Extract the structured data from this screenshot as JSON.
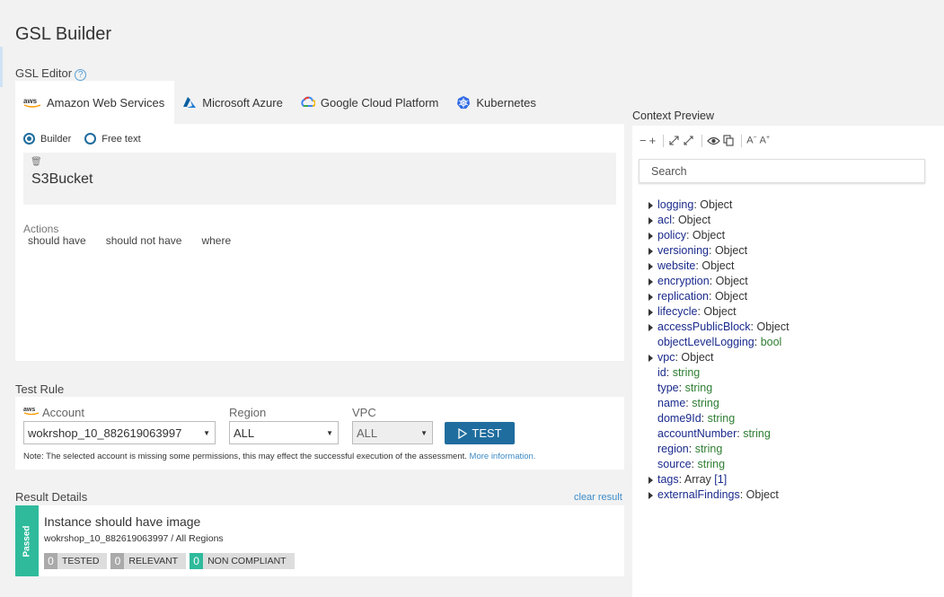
{
  "page": {
    "title": "GSL Builder"
  },
  "editor": {
    "label": "GSL Editor",
    "help_glyph": "?",
    "tabs": [
      {
        "label": "Amazon Web Services",
        "active": true
      },
      {
        "label": "Microsoft Azure",
        "active": false
      },
      {
        "label": "Google Cloud Platform",
        "active": false
      },
      {
        "label": "Kubernetes",
        "active": false
      }
    ],
    "aws_logo_text": "aws",
    "modes": [
      {
        "label": "Builder",
        "selected": true
      },
      {
        "label": "Free text",
        "selected": false
      }
    ],
    "gsl_text": "S3Bucket",
    "actions_label": "Actions",
    "actions": [
      "should have",
      "should not have",
      "where"
    ]
  },
  "test_rule": {
    "label": "Test Rule",
    "account": {
      "label": "Account",
      "value": "wokrshop_10_882619063997"
    },
    "region": {
      "label": "Region",
      "value": "ALL"
    },
    "vpc": {
      "label": "VPC",
      "value": "ALL"
    },
    "test_button": "TEST",
    "note": "Note: The selected account is missing some permissions, this may effect the successful execution of the assessment.",
    "note_link": "More information."
  },
  "result": {
    "label": "Result Details",
    "clear": "clear result",
    "status": "Passed",
    "title": "Instance should have image",
    "subtitle": "wokrshop_10_882619063997 / All Regions",
    "stats": [
      {
        "count": "0",
        "label": "TESTED"
      },
      {
        "count": "0",
        "label": "RELEVANT"
      },
      {
        "count": "0",
        "label": "NON COMPLIANT"
      }
    ]
  },
  "context": {
    "label": "Context Preview",
    "search_placeholder": "Search",
    "tree": [
      {
        "key": "logging",
        "value": "Object",
        "type": "object",
        "expandable": true
      },
      {
        "key": "acl",
        "value": "Object",
        "type": "object",
        "expandable": true
      },
      {
        "key": "policy",
        "value": "Object",
        "type": "object",
        "expandable": true
      },
      {
        "key": "versioning",
        "value": "Object",
        "type": "object",
        "expandable": true
      },
      {
        "key": "website",
        "value": "Object",
        "type": "object",
        "expandable": true
      },
      {
        "key": "encryption",
        "value": "Object",
        "type": "object",
        "expandable": true
      },
      {
        "key": "replication",
        "value": "Object",
        "type": "object",
        "expandable": true
      },
      {
        "key": "lifecycle",
        "value": "Object",
        "type": "object",
        "expandable": true
      },
      {
        "key": "accessPublicBlock",
        "value": "Object",
        "type": "object",
        "expandable": true
      },
      {
        "key": "objectLevelLogging",
        "value": "bool",
        "type": "prim",
        "expandable": false
      },
      {
        "key": "vpc",
        "value": "Object",
        "type": "object",
        "expandable": true
      },
      {
        "key": "id",
        "value": "string",
        "type": "prim",
        "expandable": false
      },
      {
        "key": "type",
        "value": "string",
        "type": "prim",
        "expandable": false
      },
      {
        "key": "name",
        "value": "string",
        "type": "prim",
        "expandable": false
      },
      {
        "key": "dome9Id",
        "value": "string",
        "type": "prim",
        "expandable": false
      },
      {
        "key": "accountNumber",
        "value": "string",
        "type": "prim",
        "expandable": false
      },
      {
        "key": "region",
        "value": "string",
        "type": "prim",
        "expandable": false
      },
      {
        "key": "source",
        "value": "string",
        "type": "prim",
        "expandable": false
      },
      {
        "key": "tags",
        "value": "Array",
        "suffix": "[1]",
        "type": "array",
        "expandable": true
      },
      {
        "key": "externalFindings",
        "value": "Object",
        "type": "object",
        "expandable": true
      }
    ]
  },
  "colors": {
    "accent": "#1f6d9e",
    "passed": "#2fba9c",
    "link": "#3d8bc9"
  }
}
